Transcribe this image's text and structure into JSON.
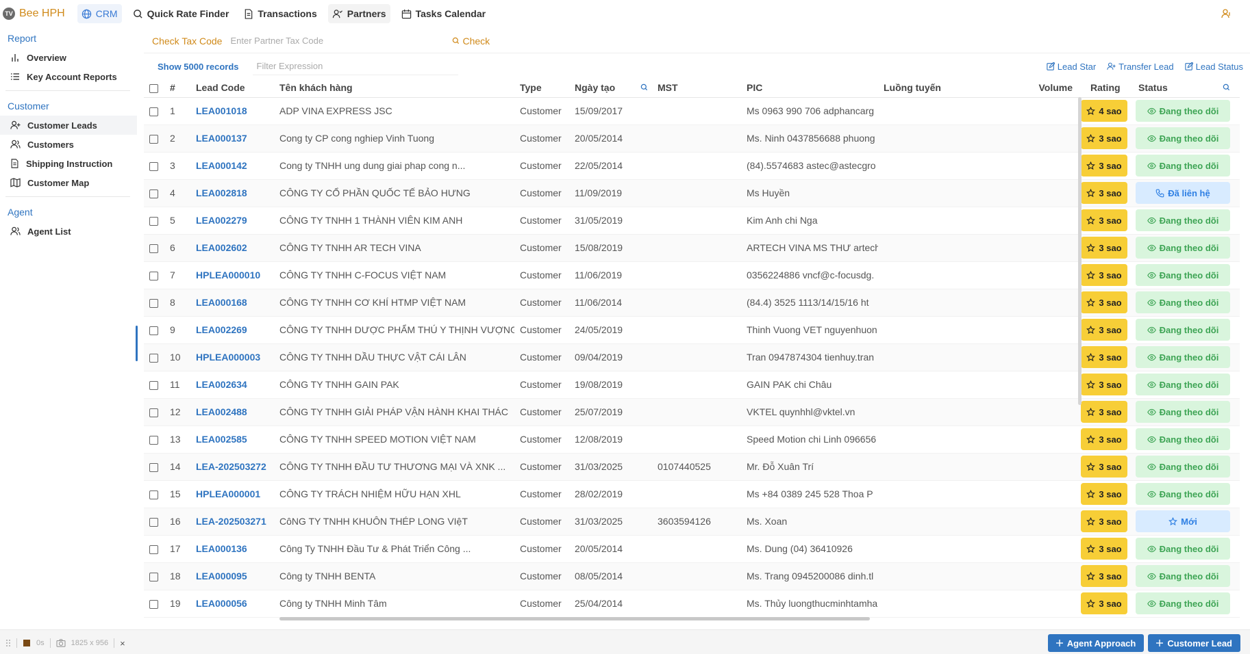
{
  "app": {
    "logo_text": "TV",
    "name": "Bee HPH",
    "nav": [
      {
        "label": "CRM",
        "icon": "globe-icon"
      },
      {
        "label": "Quick Rate Finder",
        "icon": "search-icon"
      },
      {
        "label": "Transactions",
        "icon": "document-icon"
      },
      {
        "label": "Partners",
        "icon": "partners-icon"
      },
      {
        "label": "Tasks Calendar",
        "icon": "calendar-icon"
      }
    ]
  },
  "sidebar": {
    "sections": [
      {
        "title": "Report",
        "items": [
          {
            "label": "Overview",
            "icon": "bar-chart-icon"
          },
          {
            "label": "Key Account Reports",
            "icon": "list-icon"
          }
        ]
      },
      {
        "title": "Customer",
        "items": [
          {
            "label": "Customer Leads",
            "icon": "user-plus-icon"
          },
          {
            "label": "Customers",
            "icon": "users-icon"
          },
          {
            "label": "Shipping Instruction",
            "icon": "document-icon"
          },
          {
            "label": "Customer Map",
            "icon": "map-icon"
          }
        ]
      },
      {
        "title": "Agent",
        "items": [
          {
            "label": "Agent List",
            "icon": "users-icon"
          }
        ]
      }
    ]
  },
  "tax": {
    "label": "Check Tax Code",
    "placeholder": "Enter Partner Tax Code",
    "button": "Check"
  },
  "toolbar": {
    "show_records": "Show 5000 records",
    "filter_placeholder": "Filter Expression",
    "actions": [
      "Lead Star",
      "Transfer Lead",
      "Lead Status"
    ]
  },
  "table": {
    "headers": {
      "no": "#",
      "lead_code": "Lead Code",
      "name": "Tên khách hàng",
      "type": "Type",
      "date": "Ngày tạo",
      "mst": "MST",
      "pic": "PIC",
      "route": "Luồng tuyến",
      "volume": "Volume",
      "rating": "Rating",
      "status": "Status"
    },
    "rows": [
      {
        "no": "1",
        "code": "LEA001018",
        "name": "ADP VINA EXPRESS JSC",
        "type": "Customer",
        "date": "15/09/2017",
        "mst": "",
        "pic": "Ms 0963 990 706 adphancarg",
        "rating": "4 sao",
        "status": "Đang theo dõi",
        "status_kind": "follow"
      },
      {
        "no": "2",
        "code": "LEA000137",
        "name": "Cong ty CP cong nghiep Vinh Tuong",
        "type": "Customer",
        "date": "20/05/2014",
        "mst": "",
        "pic": "Ms. Ninh 0437856688 phuong",
        "rating": "3 sao",
        "status": "Đang theo dõi",
        "status_kind": "follow"
      },
      {
        "no": "3",
        "code": "LEA000142",
        "name": "Cong ty TNHH ung dung giai phap cong n...",
        "type": "Customer",
        "date": "22/05/2014",
        "mst": "",
        "pic": "(84).5574683 astec@astecgro",
        "rating": "3 sao",
        "status": "Đang theo dõi",
        "status_kind": "follow"
      },
      {
        "no": "4",
        "code": "LEA002818",
        "name": "CÔNG TY CỔ PHẦN QUỐC TẾ BẢO HƯNG",
        "type": "Customer",
        "date": "11/09/2019",
        "mst": "",
        "pic": "Ms Huyền",
        "rating": "3 sao",
        "status": "Đã liên hệ",
        "status_kind": "contacted"
      },
      {
        "no": "5",
        "code": "LEA002279",
        "name": "CÔNG TY TNHH 1 THÀNH VIÊN KIM ANH",
        "type": "Customer",
        "date": "31/05/2019",
        "mst": "",
        "pic": "Kim Anh chi Nga",
        "rating": "3 sao",
        "status": "Đang theo dõi",
        "status_kind": "follow"
      },
      {
        "no": "6",
        "code": "LEA002602",
        "name": "CÔNG TY TNHH AR TECH VINA",
        "type": "Customer",
        "date": "15/08/2019",
        "mst": "",
        "pic": "ARTECH VINA MS THƯ artech",
        "rating": "3 sao",
        "status": "Đang theo dõi",
        "status_kind": "follow"
      },
      {
        "no": "7",
        "code": "HPLEA000010",
        "name": "CÔNG TY TNHH C-FOCUS VIỆT NAM",
        "type": "Customer",
        "date": "11/06/2019",
        "mst": "",
        "pic": "0356224886 vncf@c-focusdg.",
        "rating": "3 sao",
        "status": "Đang theo dõi",
        "status_kind": "follow"
      },
      {
        "no": "8",
        "code": "LEA000168",
        "name": "CÔNG TY TNHH CƠ KHÍ HTMP VIỆT NAM",
        "type": "Customer",
        "date": "11/06/2014",
        "mst": "",
        "pic": "(84.4) 3525 1113/14/15/16 ht",
        "rating": "3 sao",
        "status": "Đang theo dõi",
        "status_kind": "follow"
      },
      {
        "no": "9",
        "code": "LEA002269",
        "name": "CÔNG TY TNHH DƯỢC PHẨM THÚ Y THỊNH VƯỢNG",
        "type": "Customer",
        "date": "24/05/2019",
        "mst": "",
        "pic": "Thinh Vuong VET nguyenhuon",
        "rating": "3 sao",
        "status": "Đang theo dõi",
        "status_kind": "follow"
      },
      {
        "no": "10",
        "code": "HPLEA000003",
        "name": "CÔNG TY TNHH DẦU THỰC VẬT CÁI LÂN",
        "type": "Customer",
        "date": "09/04/2019",
        "mst": "",
        "pic": "Tran 0947874304 tienhuy.tran",
        "rating": "3 sao",
        "status": "Đang theo dõi",
        "status_kind": "follow"
      },
      {
        "no": "11",
        "code": "LEA002634",
        "name": "CÔNG TY TNHH GAIN PAK",
        "type": "Customer",
        "date": "19/08/2019",
        "mst": "",
        "pic": "GAIN PAK chi Châu",
        "rating": "3 sao",
        "status": "Đang theo dõi",
        "status_kind": "follow"
      },
      {
        "no": "12",
        "code": "LEA002488",
        "name": "CÔNG TY TNHH GIẢI PHÁP VẬN HÀNH KHAI THÁC",
        "type": "Customer",
        "date": "25/07/2019",
        "mst": "",
        "pic": "VKTEL quynhhl@vktel.vn",
        "rating": "3 sao",
        "status": "Đang theo dõi",
        "status_kind": "follow"
      },
      {
        "no": "13",
        "code": "LEA002585",
        "name": "CÔNG TY TNHH SPEED MOTION VIỆT NAM",
        "type": "Customer",
        "date": "12/08/2019",
        "mst": "",
        "pic": "Speed Motion chi Linh 096656",
        "rating": "3 sao",
        "status": "Đang theo dõi",
        "status_kind": "follow"
      },
      {
        "no": "14",
        "code": "LEA-202503272",
        "name": "CÔNG TY TNHH ĐẦU TƯ THƯƠNG MẠI VÀ XNK ...",
        "type": "Customer",
        "date": "31/03/2025",
        "mst": "0107440525",
        "pic": "Mr. Đỗ Xuân Trí",
        "rating": "3 sao",
        "status": "Đang theo dõi",
        "status_kind": "follow"
      },
      {
        "no": "15",
        "code": "HPLEA000001",
        "name": "CÔNG TY TRÁCH NHIỆM HỮU HẠN XHL",
        "type": "Customer",
        "date": "28/02/2019",
        "mst": "",
        "pic": "Ms +84 0389 245 528 Thoa P",
        "rating": "3 sao",
        "status": "Đang theo dõi",
        "status_kind": "follow"
      },
      {
        "no": "16",
        "code": "LEA-202503271",
        "name": "CôNG TY TNHH KHUÔN THÉP LONG VIệT",
        "type": "Customer",
        "date": "31/03/2025",
        "mst": "3603594126",
        "pic": "Ms. Xoan",
        "rating": "3 sao",
        "status": "Mới",
        "status_kind": "new"
      },
      {
        "no": "17",
        "code": "LEA000136",
        "name": "Công Ty TNHH Đầu Tư & Phát Triển Công ...",
        "type": "Customer",
        "date": "20/05/2014",
        "mst": "",
        "pic": "Ms. Dung (04) 36410926",
        "rating": "3 sao",
        "status": "Đang theo dõi",
        "status_kind": "follow"
      },
      {
        "no": "18",
        "code": "LEA000095",
        "name": "Công ty TNHH BENTA",
        "type": "Customer",
        "date": "08/05/2014",
        "mst": "",
        "pic": "Ms. Trang 0945200086 dinh.tl",
        "rating": "3 sao",
        "status": "Đang theo dõi",
        "status_kind": "follow"
      },
      {
        "no": "19",
        "code": "LEA000056",
        "name": "Công ty TNHH Minh Tâm",
        "type": "Customer",
        "date": "25/04/2014",
        "mst": "",
        "pic": "Ms. Thủy luongthucminhtamha",
        "rating": "3 sao",
        "status": "Đang theo dõi",
        "status_kind": "follow"
      }
    ]
  },
  "bottom": {
    "dev_zero": "0s",
    "dev_size": "1825 x 956",
    "dev_close": "×",
    "buttons": [
      "Agent Approach",
      "Customer Lead"
    ]
  },
  "colors": {
    "accent": "#2f74c0",
    "brand": "#d08a1a",
    "rating_bg": "#f7ce37",
    "follow_bg": "#d9f5dd",
    "follow_fg": "#3da454",
    "contacted_bg": "#d8ebff",
    "contacted_fg": "#2e7fe3"
  }
}
